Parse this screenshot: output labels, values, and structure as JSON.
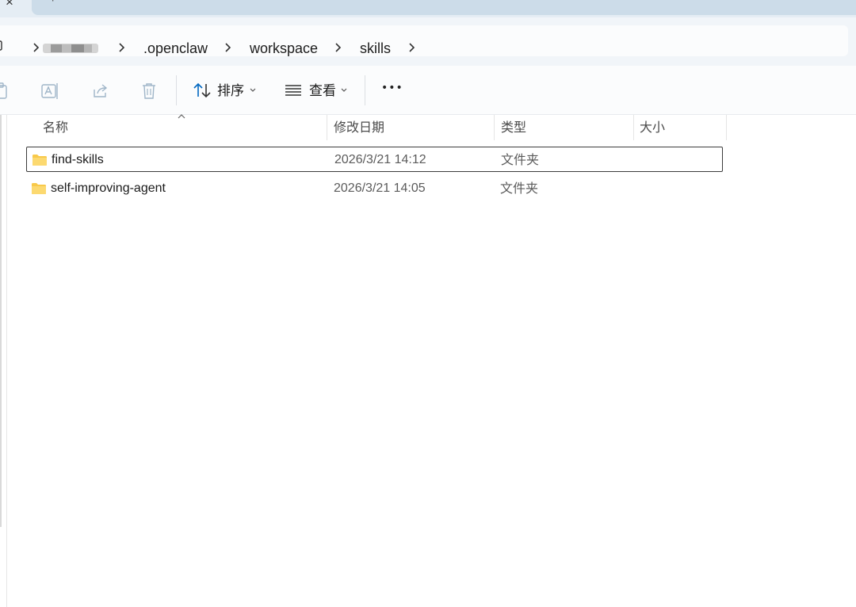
{
  "tabs": {
    "close_glyph": "×",
    "new_tab_glyph": "+"
  },
  "breadcrumb": {
    "items": [
      "",
      ".openclaw",
      "workspace",
      "skills"
    ]
  },
  "toolbar": {
    "icons": [
      "paste-icon",
      "rename-icon",
      "share-icon",
      "delete-icon"
    ],
    "sort_label": "排序",
    "view_label": "查看",
    "more_label": "•••"
  },
  "columns": {
    "name": "名称",
    "date": "修改日期",
    "type": "类型",
    "size": "大小"
  },
  "files": [
    {
      "name": "find-skills",
      "date": "2026/3/21 14:12",
      "type": "文件夹",
      "size": "",
      "selected": true
    },
    {
      "name": "self-improving-agent",
      "date": "2026/3/21 14:05",
      "type": "文件夹",
      "size": "",
      "selected": false
    }
  ],
  "colors": {
    "accent": "#0067c0",
    "folder": "#f8c94a",
    "tabstrip": "#e5edf4",
    "address_area": "#f1f5f9"
  }
}
